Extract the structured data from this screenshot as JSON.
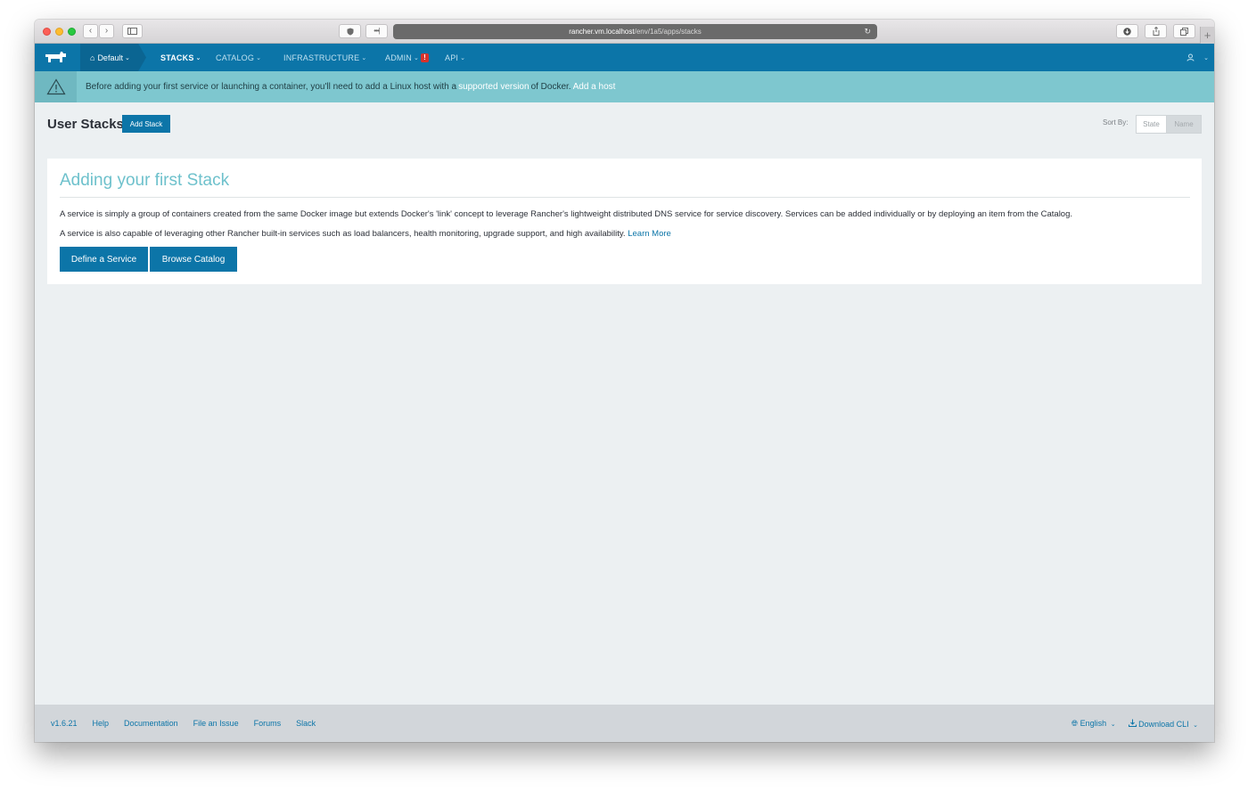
{
  "browser": {
    "url_host": "rancher.vm.localhost",
    "url_path": "/env/1a5/apps/stacks"
  },
  "nav": {
    "environment": "Default",
    "items": [
      {
        "label": "STACKS",
        "active": true
      },
      {
        "label": "CATALOG",
        "active": false
      },
      {
        "label": "INFRASTRUCTURE",
        "active": false
      },
      {
        "label": "ADMIN",
        "active": false,
        "badge": "!"
      },
      {
        "label": "API",
        "active": false
      }
    ]
  },
  "banner": {
    "text_before": "Before adding your first service or launching a container, you'll need to add a Linux host with a",
    "link_supported": "supported version",
    "text_middle": "of Docker.",
    "link_add_host": "Add a host"
  },
  "page": {
    "title": "User Stacks",
    "add_stack_label": "Add Stack",
    "sort_label": "Sort By:",
    "sort_options": [
      "State",
      "Name"
    ],
    "sort_selected": "Name"
  },
  "card": {
    "title": "Adding your first Stack",
    "paragraph1": "A service is simply a group of containers created from the same Docker image but extends Docker's 'link' concept to leverage Rancher's lightweight distributed DNS service for service discovery. Services can be added individually or by deploying an item from the Catalog.",
    "paragraph2": "A service is also capable of leveraging other Rancher built-in services such as load balancers, health monitoring, upgrade support, and high availability.",
    "learn_more": "Learn More",
    "define_service_label": "Define a Service",
    "browse_catalog_label": "Browse Catalog"
  },
  "footer": {
    "version": "v1.6.21",
    "links": [
      "Help",
      "Documentation",
      "File an Issue",
      "Forums",
      "Slack"
    ],
    "language": "English",
    "download_cli": "Download CLI"
  },
  "colors": {
    "primary": "#0c75a8",
    "banner": "#7ec7cf",
    "card_title": "#6ec1cc",
    "alert": "#d9322b"
  }
}
